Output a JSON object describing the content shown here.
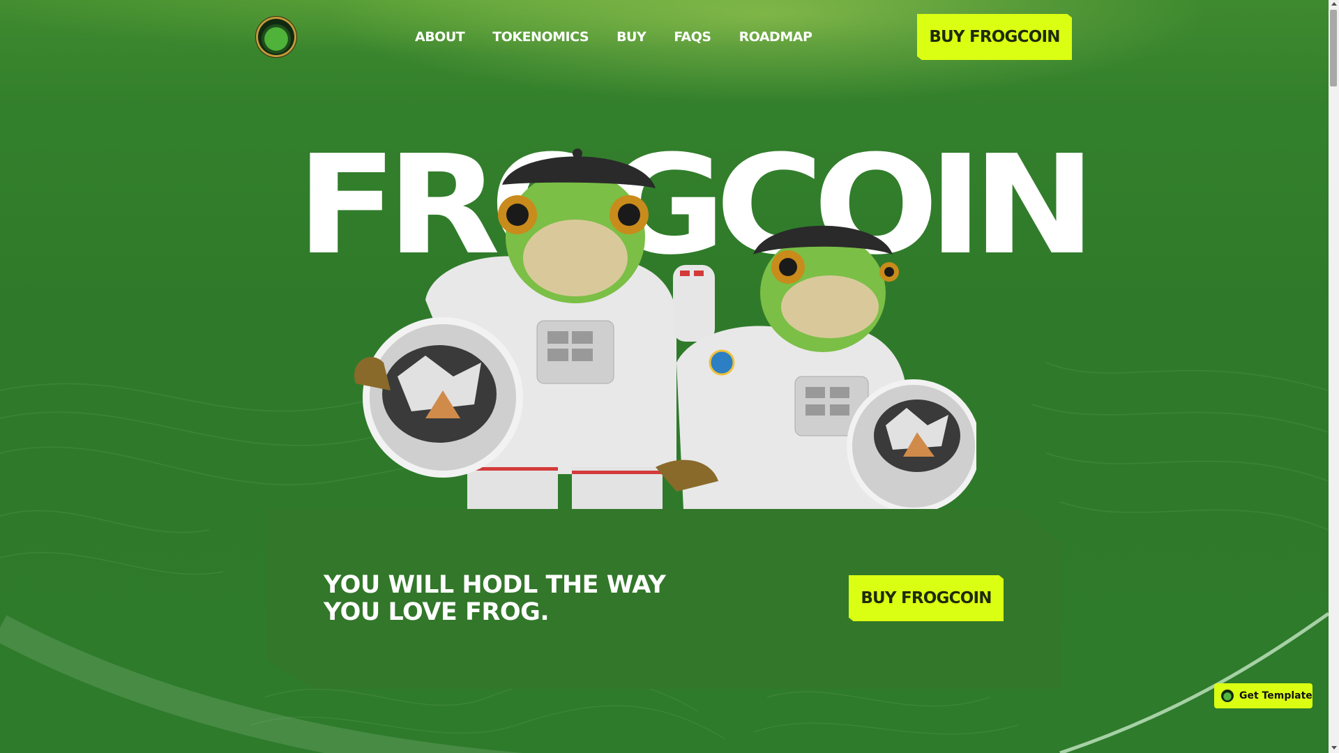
{
  "nav": {
    "logo_icon": "frogcoin-logo-icon",
    "items": [
      "ABOUT",
      "TOKENOMICS",
      "BUY",
      "FAQS",
      "ROADMAP"
    ],
    "cta_label": "BUY FROGCOIN"
  },
  "hero": {
    "title": "FROGCOIN",
    "illustration": "two-astronaut-frogs",
    "tagline_line1": "YOU WILL HODL THE WAY",
    "tagline_line2": "YOU LOVE FROG.",
    "cta_label": "BUY FROGCOIN"
  },
  "floating": {
    "get_template_label": "Get Template",
    "icon": "frogcoin-mini-icon"
  },
  "colors": {
    "background": "#2f7a2a",
    "accent": "#dbff12",
    "card": "#32772a",
    "text": "#ffffff"
  }
}
